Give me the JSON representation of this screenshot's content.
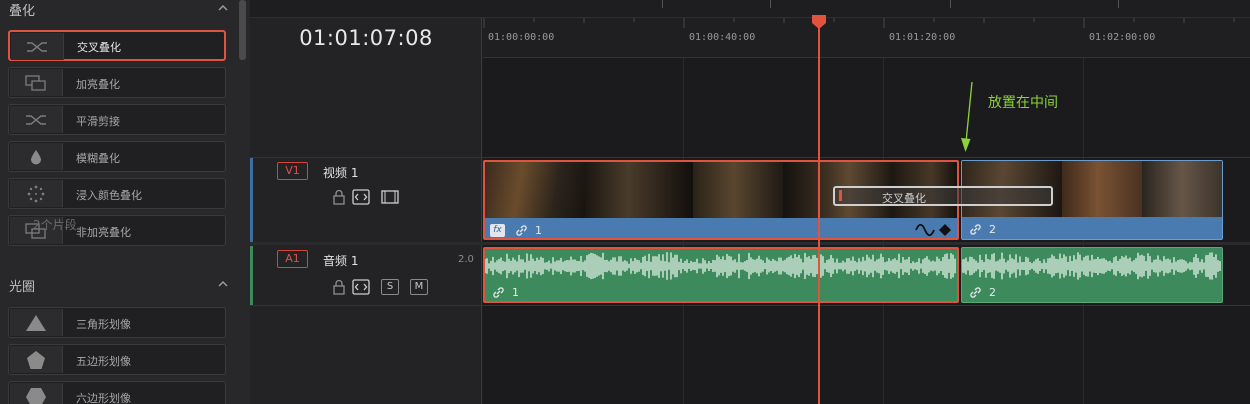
{
  "panels": {
    "dissolve": {
      "title": "叠化",
      "items": [
        {
          "label": "交叉叠化",
          "icon": "cross-dissolve-icon"
        },
        {
          "label": "加亮叠化",
          "icon": "additive-dissolve-icon"
        },
        {
          "label": "平滑剪接",
          "icon": "smooth-cut-icon"
        },
        {
          "label": "模糊叠化",
          "icon": "blur-dissolve-icon"
        },
        {
          "label": "浸入颜色叠化",
          "icon": "dip-to-color-icon"
        },
        {
          "label": "非加亮叠化",
          "icon": "non-additive-dissolve-icon"
        }
      ]
    },
    "iris": {
      "title": "光圈",
      "items": [
        {
          "label": "三角形划像",
          "icon": "triangle-iris-icon"
        },
        {
          "label": "五边形划像",
          "icon": "pentagon-iris-icon"
        },
        {
          "label": "六边形划像",
          "icon": "hexagon-iris-icon"
        }
      ]
    }
  },
  "timeline": {
    "timecode": "01:01:07:08",
    "ruler": [
      "01:00:00:00",
      "01:00:40:00",
      "01:01:20:00",
      "01:02:00:00"
    ],
    "annotation": "放置在中间",
    "tracks": {
      "video": {
        "id": "V1",
        "name": "视频 1",
        "clip_count": "2个片段"
      },
      "audio": {
        "id": "A1",
        "name": "音频 1",
        "channels": "2.0",
        "solo": "S",
        "mute": "M"
      }
    },
    "clips": {
      "video1": {
        "fx": "fx",
        "number": "1"
      },
      "video2": {
        "number": "2"
      },
      "audio1": {
        "number": "1"
      },
      "audio2": {
        "number": "2"
      }
    },
    "transition_label": "交叉叠化"
  },
  "colors": {
    "accent_red": "#e0533f",
    "video_clip": "#4a7bb0",
    "audio_clip": "#3d8a5c",
    "annotation_green": "#8cd23a"
  }
}
